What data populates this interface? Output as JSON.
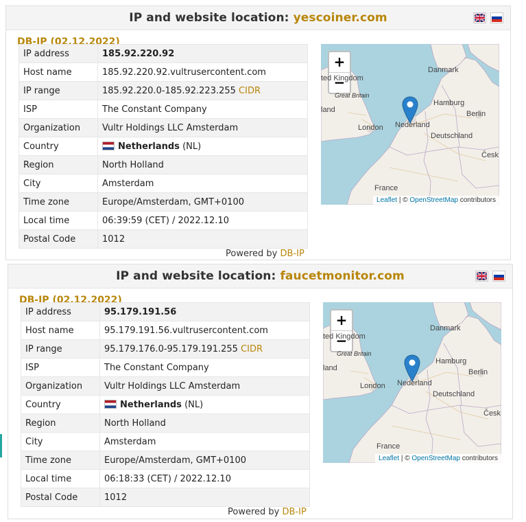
{
  "panels": [
    {
      "title_prefix": "IP and website location:",
      "domain": "yescoiner.com",
      "source_label": "DB-IP (02.12.2022)",
      "rows": {
        "ip_address": {
          "label": "IP address",
          "value": "185.92.220.92"
        },
        "host_name": {
          "label": "Host name",
          "value": "185.92.220.92.vultrusercontent.com"
        },
        "ip_range": {
          "label": "IP range",
          "value": "185.92.220.0-185.92.223.255",
          "link": "CIDR"
        },
        "isp": {
          "label": "ISP",
          "value": "The Constant Company"
        },
        "organization": {
          "label": "Organization",
          "value": "Vultr Holdings LLC Amsterdam"
        },
        "country": {
          "label": "Country",
          "name": "Netherlands",
          "code": "(NL)"
        },
        "region": {
          "label": "Region",
          "value": "North Holland"
        },
        "city": {
          "label": "City",
          "value": "Amsterdam"
        },
        "time_zone": {
          "label": "Time zone",
          "value": "Europe/Amsterdam, GMT+0100"
        },
        "local_time": {
          "label": "Local time",
          "value": "06:39:59 (CET) / 2022.12.10"
        },
        "postal_code": {
          "label": "Postal Code",
          "value": "1012"
        }
      },
      "powered_by": "Powered by",
      "powered_link": "DB-IP"
    },
    {
      "title_prefix": "IP and website location:",
      "domain": "faucetmonitor.com",
      "source_label": "DB-IP (02.12.2022)",
      "rows": {
        "ip_address": {
          "label": "IP address",
          "value": "95.179.191.56"
        },
        "host_name": {
          "label": "Host name",
          "value": "95.179.191.56.vultrusercontent.com"
        },
        "ip_range": {
          "label": "IP range",
          "value": "95.179.176.0-95.179.191.255",
          "link": "CIDR"
        },
        "isp": {
          "label": "ISP",
          "value": "The Constant Company"
        },
        "organization": {
          "label": "Organization",
          "value": "Vultr Holdings LLC Amsterdam"
        },
        "country": {
          "label": "Country",
          "name": "Netherlands",
          "code": "(NL)"
        },
        "region": {
          "label": "Region",
          "value": "North Holland"
        },
        "city": {
          "label": "City",
          "value": "Amsterdam"
        },
        "time_zone": {
          "label": "Time zone",
          "value": "Europe/Amsterdam, GMT+0100"
        },
        "local_time": {
          "label": "Local time",
          "value": "06:18:33 (CET) / 2022.12.10"
        },
        "postal_code": {
          "label": "Postal Code",
          "value": "1012"
        }
      },
      "powered_by": "Powered by",
      "powered_link": "DB-IP"
    }
  ],
  "map": {
    "zoom_in": "+",
    "zoom_out": "−",
    "attribution_leaflet": "Leaflet",
    "attribution_sep": "| ©",
    "attribution_osm": "OpenStreetMap",
    "attribution_suffix": "contributors",
    "labels": {
      "kingdom": "ted Kingdom",
      "great_britain": "Great Britain",
      "land": "land",
      "london": "London",
      "nederland": "Nederland",
      "danmark": "Danmark",
      "hamburg": "Hamburg",
      "berlin": "Berlin",
      "deutschland": "Deutschland",
      "cesk": "Česk",
      "france": "France"
    }
  },
  "colors": {
    "accent": "#b8860b",
    "map_water": "#aad3df",
    "map_land": "#f2efe9",
    "marker": "#2a81cb"
  }
}
